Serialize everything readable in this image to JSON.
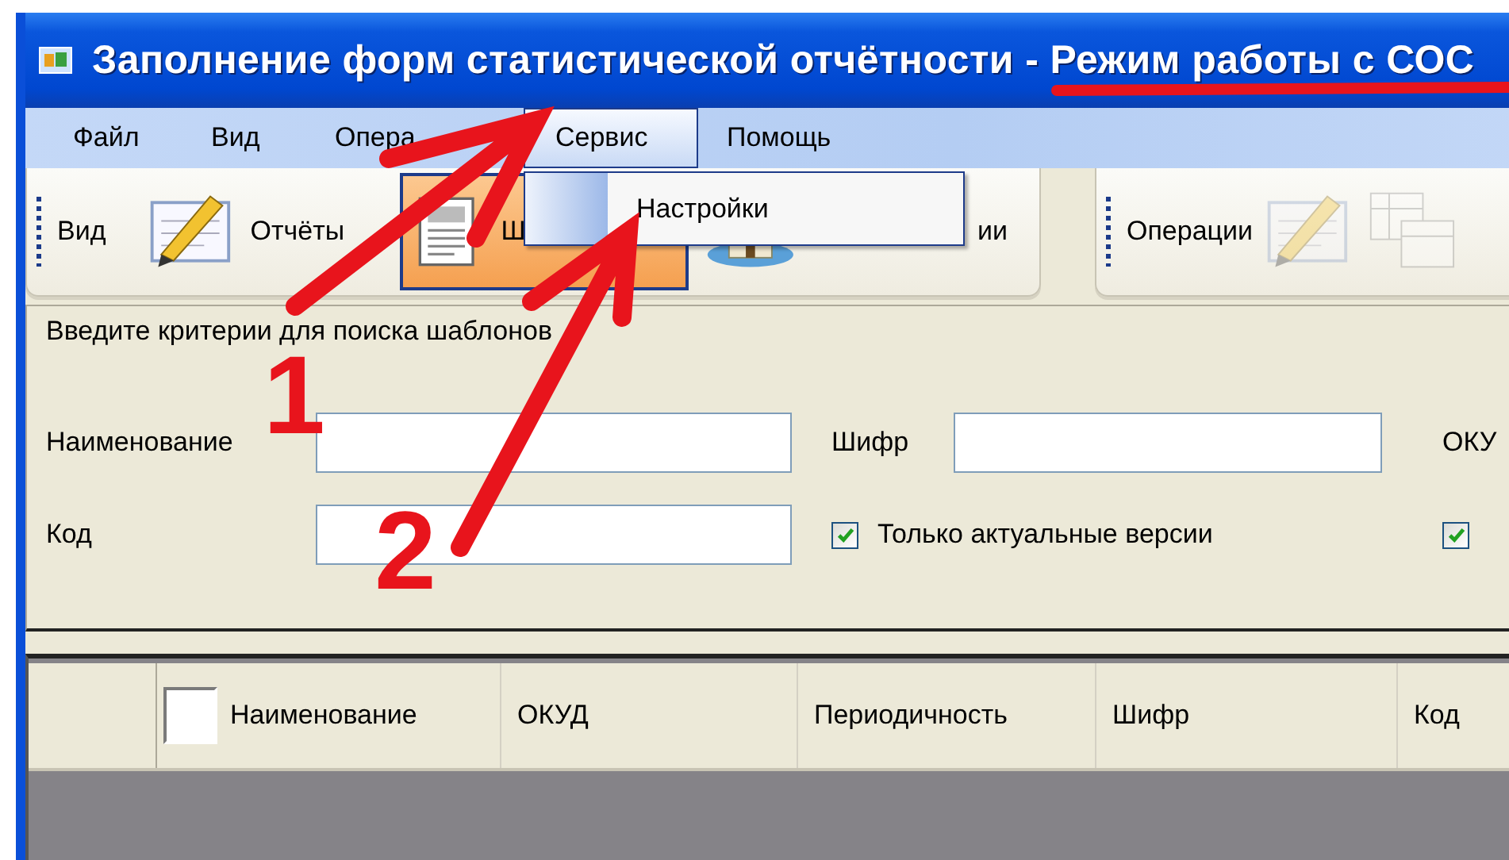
{
  "window": {
    "title": "Заполнение форм статистической отчётности - Режим работы с СОС"
  },
  "menu": [
    {
      "label": "Файл",
      "selected": false
    },
    {
      "label": "Вид",
      "selected": false
    },
    {
      "label": "Опера",
      "selected": false
    },
    {
      "label": "Сервис",
      "selected": true
    },
    {
      "label": "Помощь",
      "selected": false
    }
  ],
  "dropdown": {
    "items": [
      "Настройки"
    ]
  },
  "toolbars": [
    {
      "title": "Вид",
      "buttons": [
        {
          "label": "Отчёты",
          "selected": false
        },
        {
          "label": "Ш",
          "selected": true
        },
        {
          "label": "ии",
          "selected": false
        }
      ]
    },
    {
      "title": "Операции",
      "buttons": [
        {
          "disabled": true
        },
        {
          "disabled": true
        }
      ]
    }
  ],
  "search": {
    "caption": "Введите критерии для поиска шаблонов",
    "fields": [
      {
        "label": "Наименование"
      },
      {
        "label": "Шифр"
      },
      {
        "label": "ОКУ"
      },
      {
        "label": "Код"
      }
    ],
    "checkboxes": [
      {
        "label": "Только актуальные версии",
        "checked": true
      },
      {
        "checked": true
      }
    ]
  },
  "grid": {
    "select_all": {
      "checked": false
    },
    "columns": [
      "Наименование",
      "ОКУД",
      "Периодичность",
      "Шифр",
      "Код"
    ]
  },
  "annotations": [
    {
      "kind": "arrow",
      "number": "1"
    },
    {
      "kind": "arrow",
      "number": "2"
    },
    {
      "kind": "underline"
    }
  ]
}
